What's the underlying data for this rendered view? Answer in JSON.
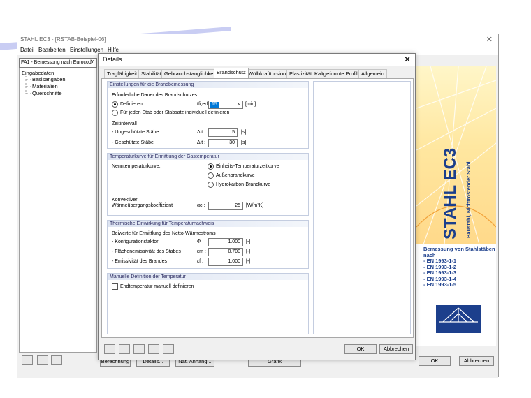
{
  "main_window": {
    "title": "STAHL EC3 - [RSTAB-Beispiel-06]",
    "menu": [
      "Datei",
      "Bearbeiten",
      "Einstellungen",
      "Hilfe"
    ],
    "case_select": "FA1 - Bemessung nach Eurocod",
    "tree": {
      "root": "Eingabedaten",
      "children": [
        "Basisangaben",
        "Materialien",
        "Querschnitte"
      ]
    },
    "bottom_buttons": [
      "Berechnung",
      "Details...",
      "Nat. Anhang...",
      "Grafik",
      "OK",
      "Abbrechen"
    ]
  },
  "splash": {
    "title": "STAHL EC3",
    "subtitle": "Baustahl, Nichtrostender Stahl",
    "heading": "Bemessung von Stahlstäben nach",
    "norms": [
      "- EN 1993-1-1",
      "- EN 1993-1-2",
      "- EN 1993-1-3",
      "- EN 1993-1-4",
      "- EN 1993-1-5"
    ],
    "colors": {
      "brand_blue": "#1c3f8c"
    }
  },
  "dialog": {
    "title": "Details",
    "tabs": [
      "Tragfähigkeit",
      "Stabilität",
      "Gebrauchstauglichkeit",
      "Brandschutz",
      "Wölbkrafttorsion",
      "Plastizität",
      "Kaltgeformte Profile",
      "Allgemein"
    ],
    "active_tab": "Brandschutz",
    "fire": {
      "header": "Einstellungen für die Brandbemessung",
      "duration_label": "Erforderliche Dauer des Brandschutzes",
      "radio_define": "Definieren",
      "tfi_symbol": "tfi,erf :",
      "tfi_value": "15",
      "tfi_unit": "[min]",
      "radio_individual": "Für jeden Stab oder Stabsatz individuell definieren",
      "interval_label": "Zeitintervall",
      "unprotected_label": "- Ungeschützte Stäbe",
      "protected_label": "- Geschützte Stäbe",
      "dt_symbol": "Δ t :",
      "unprotected_value": "5",
      "protected_value": "30",
      "sec_unit": "[s]"
    },
    "temp_curve": {
      "header": "Temperaturkurve für Ermittlung der Gastemperatur",
      "nominal_label": "Nenntemperaturkurve:",
      "options": [
        "Einheits-Temperaturzeitkurve",
        "Außenbrandkurve",
        "Hydrokarbon-Brandkurve"
      ],
      "selected_index": 0,
      "conv_label_1": "Konvektiver",
      "conv_label_2": "Wärmeübergangskoeffizient",
      "alpha_symbol": "αc :",
      "alpha_value": "25",
      "alpha_unit": "[W/m²K]"
    },
    "thermal": {
      "header": "Thermische Einwirkung für Temperaturnachweis",
      "coeff_label": "Beiwerte für Ermittlung des Netto-Wärmestroms",
      "rows": [
        {
          "label": "- Konfigurationsfaktor",
          "symbol": "Φ :",
          "value": "1.000",
          "unit": "[-]"
        },
        {
          "label": "- Flächenemissivität des Stabes",
          "symbol": "εm :",
          "value": "0.700",
          "unit": "[-]"
        },
        {
          "label": "- Emissivität des Brandes",
          "symbol": "εf :",
          "value": "1.000",
          "unit": "[-]"
        }
      ]
    },
    "manual": {
      "header": "Manuelle Definition der Temperatur",
      "checkbox_label": "Endtemperatur manuell definieren"
    },
    "buttons": {
      "ok": "OK",
      "cancel": "Abbrechen"
    }
  }
}
